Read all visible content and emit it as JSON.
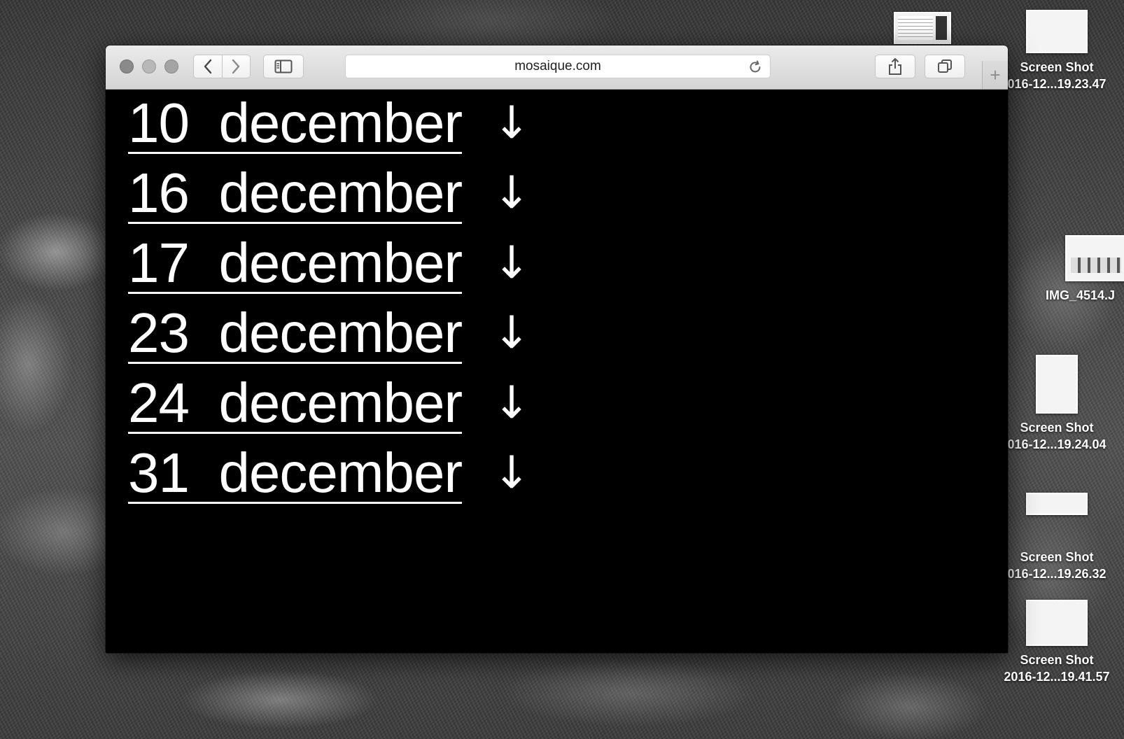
{
  "browser": {
    "url": "mosaique.com",
    "new_tab_label": "+"
  },
  "page": {
    "dates": [
      {
        "day": "10",
        "month": "december",
        "arrow": "↓"
      },
      {
        "day": "16",
        "month": "december",
        "arrow": "↓"
      },
      {
        "day": "17",
        "month": "december",
        "arrow": "↓"
      },
      {
        "day": "23",
        "month": "december",
        "arrow": "↓"
      },
      {
        "day": "24",
        "month": "december",
        "arrow": "↓"
      },
      {
        "day": "31",
        "month": "december",
        "arrow": "↓"
      }
    ]
  },
  "desktop": {
    "icons": [
      {
        "line1": "Screen Shot",
        "line2": "016-12...19.23.47"
      },
      {
        "line1": "IMG_4514.J",
        "line2": ""
      },
      {
        "line1": "Screen Shot",
        "line2": "016-12...19.24.04"
      },
      {
        "line1": "Screen Shot",
        "line2": "016-12...19.26.32"
      },
      {
        "line1": "Screen Shot",
        "line2": "2016-12...19.41.57"
      }
    ]
  },
  "colors": {
    "page_background": "#000000",
    "link_text": "#ffffff",
    "toolbar_top": "#ebebeb",
    "toolbar_bottom": "#d4d4d4"
  }
}
